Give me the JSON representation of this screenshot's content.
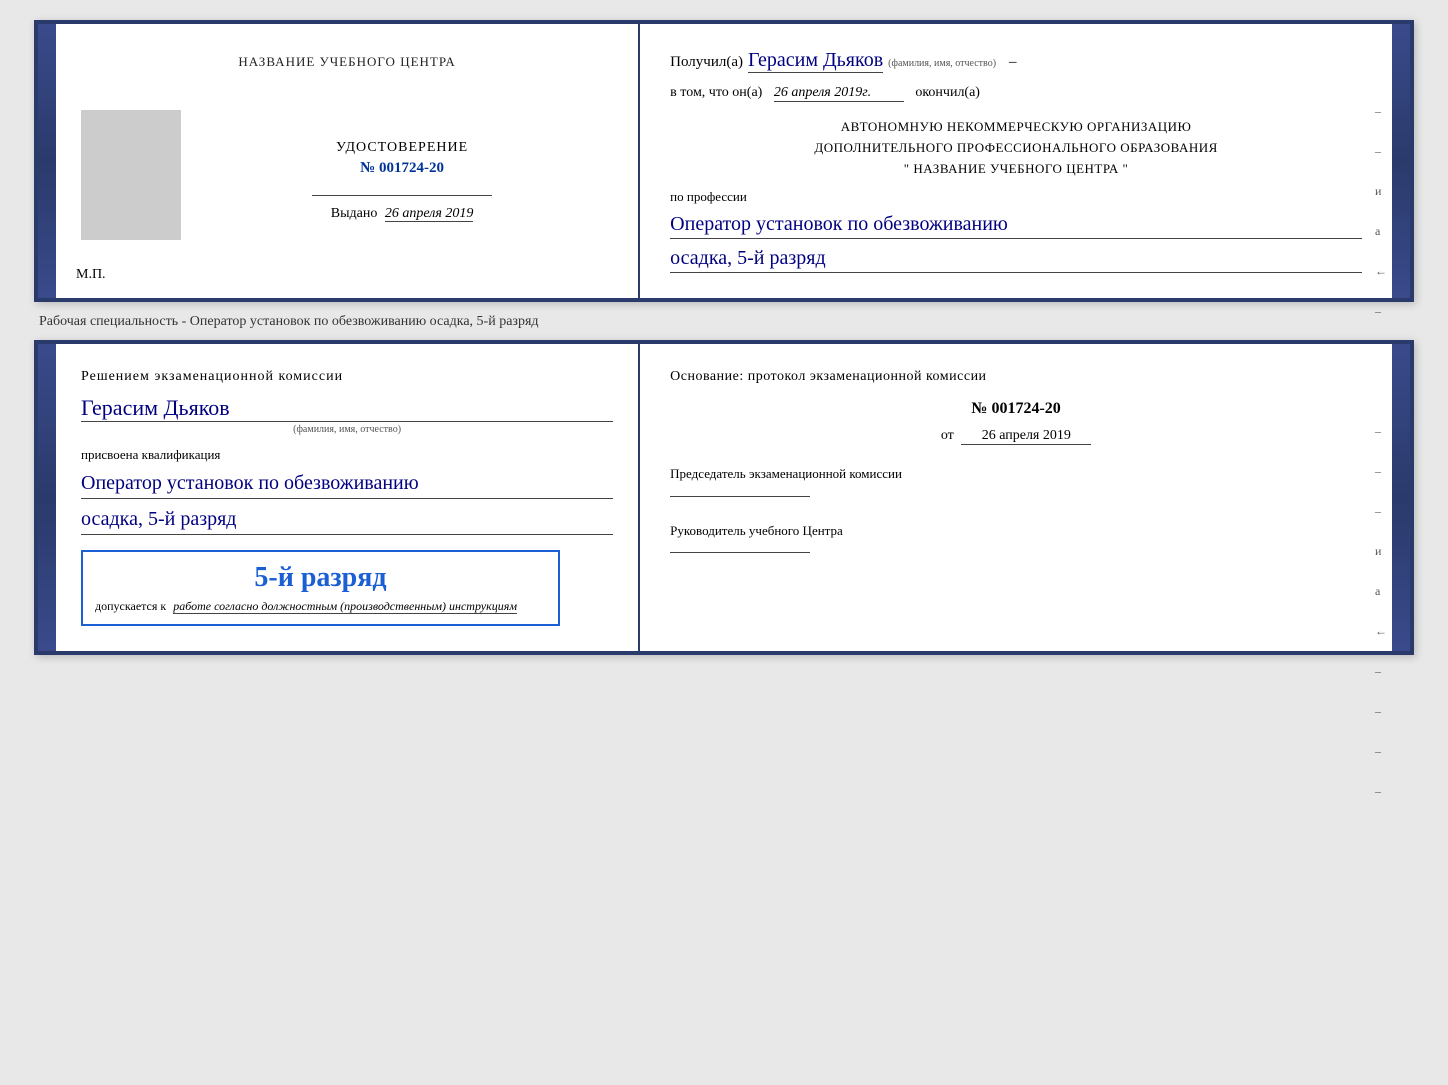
{
  "top_diploma": {
    "left": {
      "center_name": "НАЗВАНИЕ УЧЕБНОГО ЦЕНТРА",
      "udostoverenie_label": "УДОСТОВЕРЕНИЕ",
      "number": "№ 001724-20",
      "vidano_label": "Выдано",
      "vidano_date": "26 апреля 2019",
      "mp_label": "М.П."
    },
    "right": {
      "poluchil_prefix": "Получил(а)",
      "recipient_name": "Герасим Дьяков",
      "fio_sublabel": "(фамилия, имя, отчество)",
      "dash": "–",
      "vtom_prefix": "в том, что он(а)",
      "vtom_date": "26 апреля 2019г.",
      "okonchil": "окончил(а)",
      "block_line1": "АВТОНОМНУЮ НЕКОММЕРЧЕСКУЮ ОРГАНИЗАЦИЮ",
      "block_line2": "ДОПОЛНИТЕЛЬНОГО ПРОФЕССИОНАЛЬНОГО ОБРАЗОВАНИЯ",
      "block_line3": "\"  НАЗВАНИЕ УЧЕБНОГО ЦЕНТРА  \"",
      "po_professii": "по профессии",
      "profession_line1": "Оператор установок по обезвоживанию",
      "profession_line2": "осадка, 5-й разряд"
    }
  },
  "separator": {
    "text": "Рабочая специальность - Оператор установок по обезвоживанию осадка, 5-й разряд"
  },
  "bottom_exam": {
    "left": {
      "resheniem": "Решением экзаменационной комиссии",
      "recipient_name": "Герасим Дьяков",
      "fio_sublabel": "(фамилия, имя, отчество)",
      "prisvoena": "присвоена квалификация",
      "qualification_line1": "Оператор установок по обезвоживанию",
      "qualification_line2": "осадка, 5-й разряд",
      "stamp_rank": "5-й разряд",
      "dopuskaetsya_prefix": "допускается к",
      "dopuskaetsya_value": "работе согласно должностным (производственным) инструкциям"
    },
    "right": {
      "osnovanie": "Основание: протокол экзаменационной комиссии",
      "protocol_number": "№ 001724-20",
      "ot_label": "от",
      "ot_date": "26 апреля 2019",
      "predsedatel_label": "Председатель экзаменационной комиссии",
      "rukovoditel_label": "Руководитель учебного Центра"
    }
  }
}
